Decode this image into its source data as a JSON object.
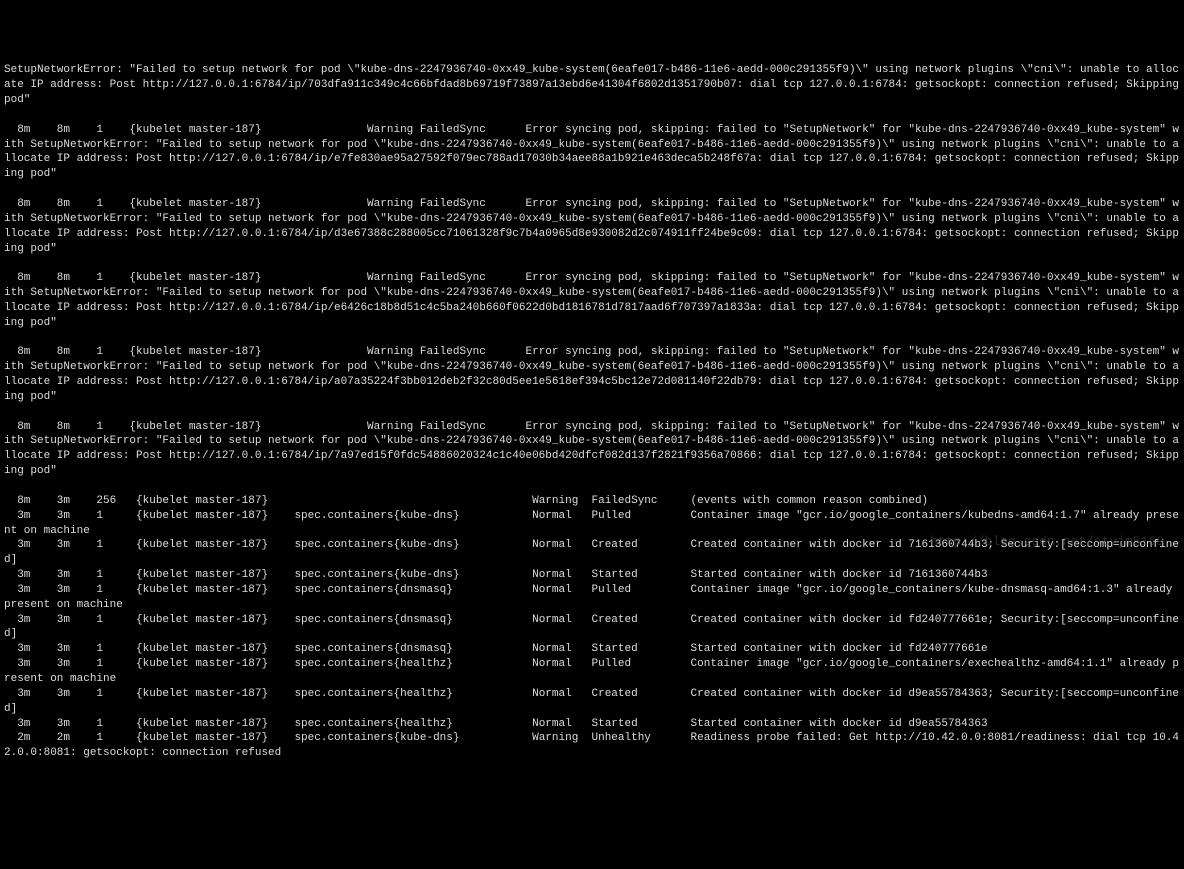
{
  "lines": [
    "SetupNetworkError: \"Failed to setup network for pod \\\"kube-dns-2247936740-0xx49_kube-system(6eafe017-b486-11e6-aedd-000c291355f9)\\\" using network plugins \\\"cni\\\": unable to allocate IP address: Post http://127.0.0.1:6784/ip/703dfa911c349c4c66bfdad8b69719f73897a13ebd6e41304f6802d1351790b07: dial tcp 127.0.0.1:6784: getsockopt: connection refused; Skipping pod\"",
    "",
    "  8m    8m    1    {kubelet master-187}                Warning FailedSync      Error syncing pod, skipping: failed to \"SetupNetwork\" for \"kube-dns-2247936740-0xx49_kube-system\" with SetupNetworkError: \"Failed to setup network for pod \\\"kube-dns-2247936740-0xx49_kube-system(6eafe017-b486-11e6-aedd-000c291355f9)\\\" using network plugins \\\"cni\\\": unable to allocate IP address: Post http://127.0.0.1:6784/ip/e7fe830ae95a27592f079ec788ad17030b34aee88a1b921e463deca5b248f67a: dial tcp 127.0.0.1:6784: getsockopt: connection refused; Skipping pod\"",
    "",
    "  8m    8m    1    {kubelet master-187}                Warning FailedSync      Error syncing pod, skipping: failed to \"SetupNetwork\" for \"kube-dns-2247936740-0xx49_kube-system\" with SetupNetworkError: \"Failed to setup network for pod \\\"kube-dns-2247936740-0xx49_kube-system(6eafe017-b486-11e6-aedd-000c291355f9)\\\" using network plugins \\\"cni\\\": unable to allocate IP address: Post http://127.0.0.1:6784/ip/d3e67388c288005cc71061328f9c7b4a0965d8e930082d2c074911ff24be9c09: dial tcp 127.0.0.1:6784: getsockopt: connection refused; Skipping pod\"",
    "",
    "  8m    8m    1    {kubelet master-187}                Warning FailedSync      Error syncing pod, skipping: failed to \"SetupNetwork\" for \"kube-dns-2247936740-0xx49_kube-system\" with SetupNetworkError: \"Failed to setup network for pod \\\"kube-dns-2247936740-0xx49_kube-system(6eafe017-b486-11e6-aedd-000c291355f9)\\\" using network plugins \\\"cni\\\": unable to allocate IP address: Post http://127.0.0.1:6784/ip/e6426c18b8d51c4c5ba240b660f0622d0bd1816781d7817aad6f707397a1833a: dial tcp 127.0.0.1:6784: getsockopt: connection refused; Skipping pod\"",
    "",
    "  8m    8m    1    {kubelet master-187}                Warning FailedSync      Error syncing pod, skipping: failed to \"SetupNetwork\" for \"kube-dns-2247936740-0xx49_kube-system\" with SetupNetworkError: \"Failed to setup network for pod \\\"kube-dns-2247936740-0xx49_kube-system(6eafe017-b486-11e6-aedd-000c291355f9)\\\" using network plugins \\\"cni\\\": unable to allocate IP address: Post http://127.0.0.1:6784/ip/a07a35224f3bb012deb2f32c80d5ee1e5618ef394c5bc12e72d081140f22db79: dial tcp 127.0.0.1:6784: getsockopt: connection refused; Skipping pod\"",
    "",
    "  8m    8m    1    {kubelet master-187}                Warning FailedSync      Error syncing pod, skipping: failed to \"SetupNetwork\" for \"kube-dns-2247936740-0xx49_kube-system\" with SetupNetworkError: \"Failed to setup network for pod \\\"kube-dns-2247936740-0xx49_kube-system(6eafe017-b486-11e6-aedd-000c291355f9)\\\" using network plugins \\\"cni\\\": unable to allocate IP address: Post http://127.0.0.1:6784/ip/7a97ed15f0fdc54886020324c1c40e06bd420dfcf082d137f2821f9356a70866: dial tcp 127.0.0.1:6784: getsockopt: connection refused; Skipping pod\"",
    "",
    "  8m    3m    256   {kubelet master-187}                                        Warning  FailedSync     (events with common reason combined)",
    "  3m    3m    1     {kubelet master-187}    spec.containers{kube-dns}           Normal   Pulled         Container image \"gcr.io/google_containers/kubedns-amd64:1.7\" already present on machine",
    "  3m    3m    1     {kubelet master-187}    spec.containers{kube-dns}           Normal   Created        Created container with docker id 7161360744b3; Security:[seccomp=unconfined]",
    "  3m    3m    1     {kubelet master-187}    spec.containers{kube-dns}           Normal   Started        Started container with docker id 7161360744b3",
    "  3m    3m    1     {kubelet master-187}    spec.containers{dnsmasq}            Normal   Pulled         Container image \"gcr.io/google_containers/kube-dnsmasq-amd64:1.3\" already present on machine",
    "  3m    3m    1     {kubelet master-187}    spec.containers{dnsmasq}            Normal   Created        Created container with docker id fd240777661e; Security:[seccomp=unconfined]",
    "  3m    3m    1     {kubelet master-187}    spec.containers{dnsmasq}            Normal   Started        Started container with docker id fd240777661e",
    "  3m    3m    1     {kubelet master-187}    spec.containers{healthz}            Normal   Pulled         Container image \"gcr.io/google_containers/exechealthz-amd64:1.1\" already present on machine",
    "  3m    3m    1     {kubelet master-187}    spec.containers{healthz}            Normal   Created        Created container with docker id d9ea55784363; Security:[seccomp=unconfined]",
    "  3m    3m    1     {kubelet master-187}    spec.containers{healthz}            Normal   Started        Started container with docker id d9ea55784363",
    "  2m    2m    1     {kubelet master-187}    spec.containers{kube-dns}           Warning  Unhealthy      Readiness probe failed: Get http://10.42.0.0:8081/readiness: dial tcp 10.42.0.0:8081: getsockopt: connection refused"
  ],
  "watermark": "http://blog.csdn.net/styjm5169"
}
